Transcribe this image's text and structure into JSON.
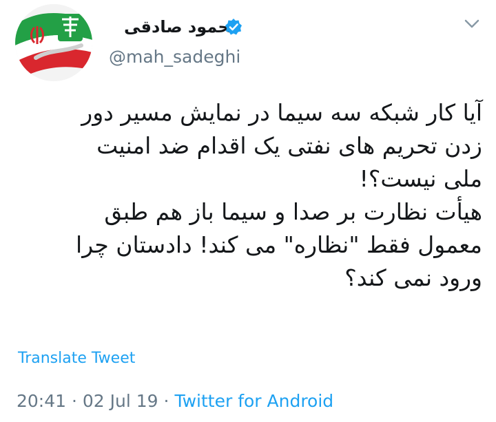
{
  "tweet": {
    "author": {
      "display_name": "محمود صادقی",
      "handle": "@mah_sadeghi",
      "verified_icon": "verified-badge-icon",
      "avatar_icon": "avatar-image"
    },
    "menu_icon": "chevron-down-icon",
    "body_lines": [
      "آیا کار شبکه سه سیما در نمایش مسیر دور",
      "زدن تحریم های نفتی یک اقدام ضد امنیت",
      "ملی نیست؟!",
      "هیأت نظارت بر صدا و سیما باز هم طبق",
      "معمول فقط \"نظاره\" می کند! دادستان چرا",
      "ورود نمی کند؟"
    ],
    "translate_label": "Translate Tweet",
    "time": "20:41",
    "separator": "·",
    "date": "02 Jul 19",
    "source": "Twitter for Android"
  },
  "colors": {
    "text": "#14171a",
    "secondary": "#657786",
    "link": "#1da1f2",
    "verified": "#1da1f2"
  }
}
